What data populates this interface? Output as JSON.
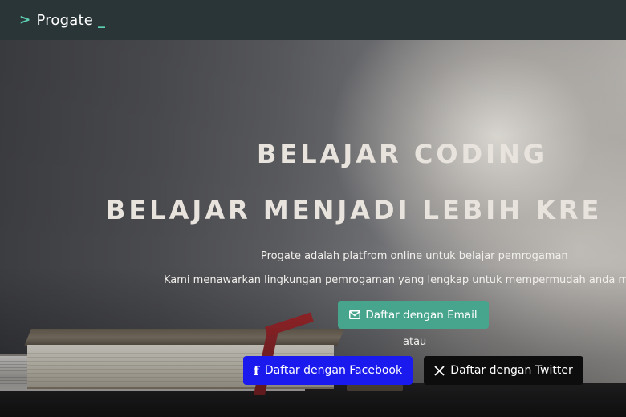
{
  "header": {
    "logo_prefix": ">",
    "logo_text": "Progate",
    "logo_cursor": "_"
  },
  "hero": {
    "headline_1": "BELAJAR CODING",
    "headline_2": "BELAJAR MENJADI LEBIH KRE",
    "description_1": "Progate adalah platfrom online untuk belajar pemrogaman",
    "description_2": "Kami menawarkan lingkungan pemrogaman yang lengkap untuk mempermudah anda m",
    "email_button_label": "Daftar dengan Email",
    "separator_text": "atau",
    "facebook_button_label": "Daftar dengan Facebook",
    "twitter_button_label": "Daftar dengan Twitter"
  },
  "icons": {
    "email": "envelope-icon",
    "facebook": "facebook-icon",
    "twitter": "x-icon"
  },
  "colors": {
    "header_bg": "#2a3538",
    "accent": "#5fd0b3",
    "email_button": "#48a58d",
    "facebook_button": "#1a1aee",
    "twitter_button": "#0d0d0d"
  }
}
